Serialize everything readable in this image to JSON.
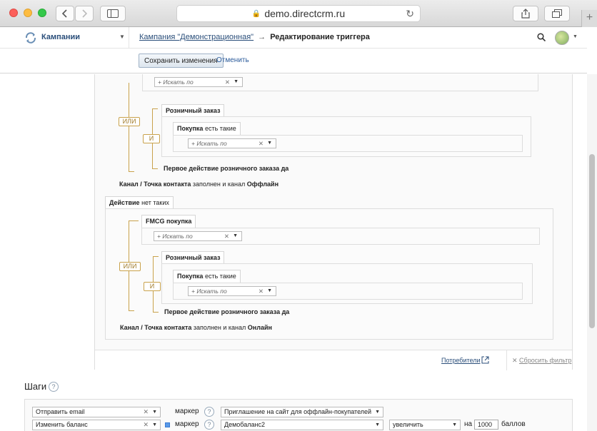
{
  "browser": {
    "url": "demo.directcrm.ru"
  },
  "header": {
    "app_name": "Кампании",
    "breadcrumb_link": "Кампания \"Демонстрационная\"",
    "breadcrumb_arrow": "→",
    "breadcrumb_current": "Редактирование триггера"
  },
  "toolbar": {
    "save_label": "Сохранить изменения",
    "cancel_label": "Отменить"
  },
  "filters": {
    "search_placeholder": "+ Искать по",
    "or_label": "ИЛИ",
    "and_label": "И",
    "block1": {
      "retail_order": "Розничный заказ",
      "purchase": "Покупка",
      "purchase_state": "есть такие",
      "first_action": "Первое действие розничного заказа да",
      "channel_prefix": "Канал / Точка контакта",
      "channel_mid": "заполнен и канал",
      "channel_value": "Оффлайн"
    },
    "action_header": "Действие",
    "action_state": "нет таких",
    "block2": {
      "fmcg": "FMCG покупка",
      "retail_order": "Розничный заказ",
      "purchase": "Покупка",
      "purchase_state": "есть такие",
      "first_action": "Первое действие розничного заказа да",
      "channel_prefix": "Канал / Точка контакта",
      "channel_mid": "заполнен и канал",
      "channel_value": "Онлайн"
    },
    "consumers_link": "Потребители",
    "reset_label": "Сбросить фильтр"
  },
  "steps": {
    "title": "Шаги",
    "help": "?",
    "row1": {
      "action": "Отправить email",
      "marker_label": "маркер",
      "marker_value": "Приглашение на сайт для оффлайн-покупателей"
    },
    "row2": {
      "action": "Изменить баланс",
      "marker_label": "маркер",
      "marker_value": "Демобаланс2",
      "operation": "увеличить",
      "on_label": "на",
      "amount": "1000",
      "unit": "баллов"
    }
  },
  "colors": {
    "logic_accent": "#c9a24c",
    "link": "#2a4e7a"
  }
}
